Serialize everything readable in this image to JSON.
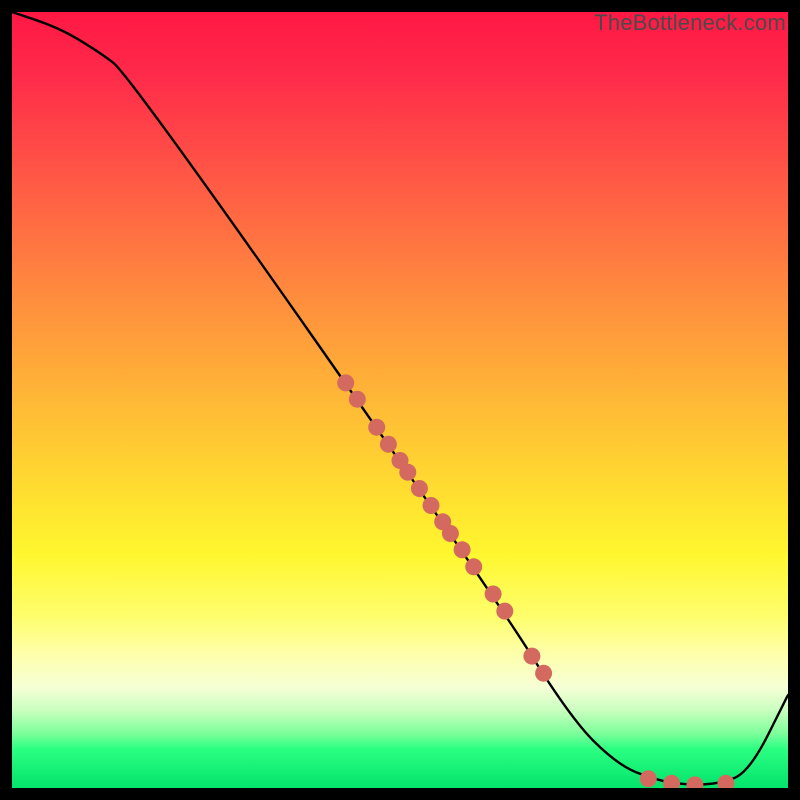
{
  "watermark": "TheBottleneck.com",
  "chart_data": {
    "type": "line",
    "title": "",
    "xlabel": "",
    "ylabel": "",
    "xlim": [
      0,
      100
    ],
    "ylim": [
      0,
      100
    ],
    "grid": false,
    "legend": false,
    "series": [
      {
        "name": "curve",
        "x": [
          0,
          6,
          11,
          15,
          62,
          72,
          78,
          83,
          87,
          91,
          95,
          100
        ],
        "y": [
          100,
          98,
          95,
          92,
          25,
          9,
          3,
          1,
          0.4,
          0.5,
          2,
          12
        ]
      }
    ],
    "scatter_points": {
      "name": "markers",
      "x": [
        43,
        44.5,
        47,
        48.5,
        50,
        51,
        52.5,
        54,
        55.5,
        56.5,
        58,
        59.5,
        62,
        63.5,
        67,
        68.5,
        82,
        85,
        88,
        92
      ],
      "y": [
        52.2,
        50.1,
        46.5,
        44.3,
        42.2,
        40.7,
        38.6,
        36.4,
        34.3,
        32.8,
        30.7,
        28.5,
        25.0,
        22.8,
        17.0,
        14.8,
        1.2,
        0.6,
        0.4,
        0.6
      ]
    },
    "marker_color": "#d46a5f",
    "line_color": "#000000"
  }
}
